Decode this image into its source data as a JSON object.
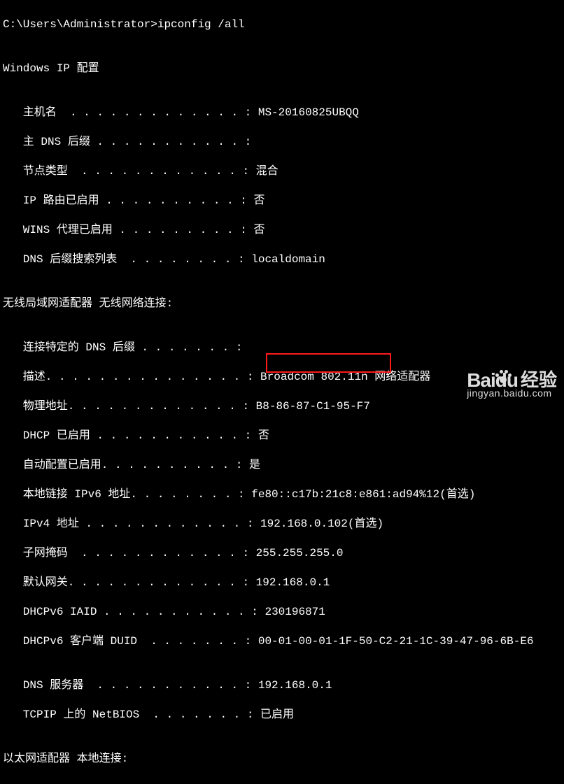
{
  "prompt": "C:\\Users\\Administrator>ipconfig /all",
  "blank": "",
  "section1_title": "Windows IP 配置",
  "host_line": "   主机名  . . . . . . . . . . . . . : MS-20160825UBQQ",
  "pdns_line": "   主 DNS 后缀 . . . . . . . . . . . :",
  "nodetype_line": "   节点类型  . . . . . . . . . . . . : 混合",
  "iproute_line": "   IP 路由已启用 . . . . . . . . . . : 否",
  "wins_line": "   WINS 代理已启用 . . . . . . . . . : 否",
  "dnssuf_line": "   DNS 后缀搜索列表  . . . . . . . . : localdomain",
  "section2_title": "无线局域网适配器 无线网络连接:",
  "conndns_line": "   连接特定的 DNS 后缀 . . . . . . . :",
  "desc_line": "   描述. . . . . . . . . . . . . . . : Broadcom 802.11n 网络适配器",
  "phys_line": "   物理地址. . . . . . . . . . . . . : B8-86-87-C1-95-F7",
  "dhcp_line": "   DHCP 已启用 . . . . . . . . . . . : 否",
  "autoconf_line": "   自动配置已启用. . . . . . . . . . : 是",
  "ipv6_line": "   本地链接 IPv6 地址. . . . . . . . : fe80::c17b:21c8:e861:ad94%12(首选)",
  "ipv4_line": "   IPv4 地址 . . . . . . . . . . . . : 192.168.0.102(首选)",
  "subnet_line": "   子网掩码  . . . . . . . . . . . . : 255.255.255.0",
  "gateway_line": "   默认网关. . . . . . . . . . . . . : 192.168.0.1",
  "iaid_line": "   DHCPv6 IAID . . . . . . . . . . . : 230196871",
  "duid_line": "   DHCPv6 客户端 DUID  . . . . . . . : 00-01-00-01-1F-50-C2-21-1C-39-47-96-6B-E6",
  "dns_line": "   DNS 服务器  . . . . . . . . . . . : 192.168.0.1",
  "netbios_line": "   TCPIP 上的 NetBIOS  . . . . . . . : 已启用",
  "footer_partial": "以太网适配器 本地连接:",
  "watermark": {
    "brand": "Bai",
    "du": "du",
    "jy": "经验",
    "url": "jingyan.baidu.com"
  },
  "highlighted_value": "192.168.0.1"
}
